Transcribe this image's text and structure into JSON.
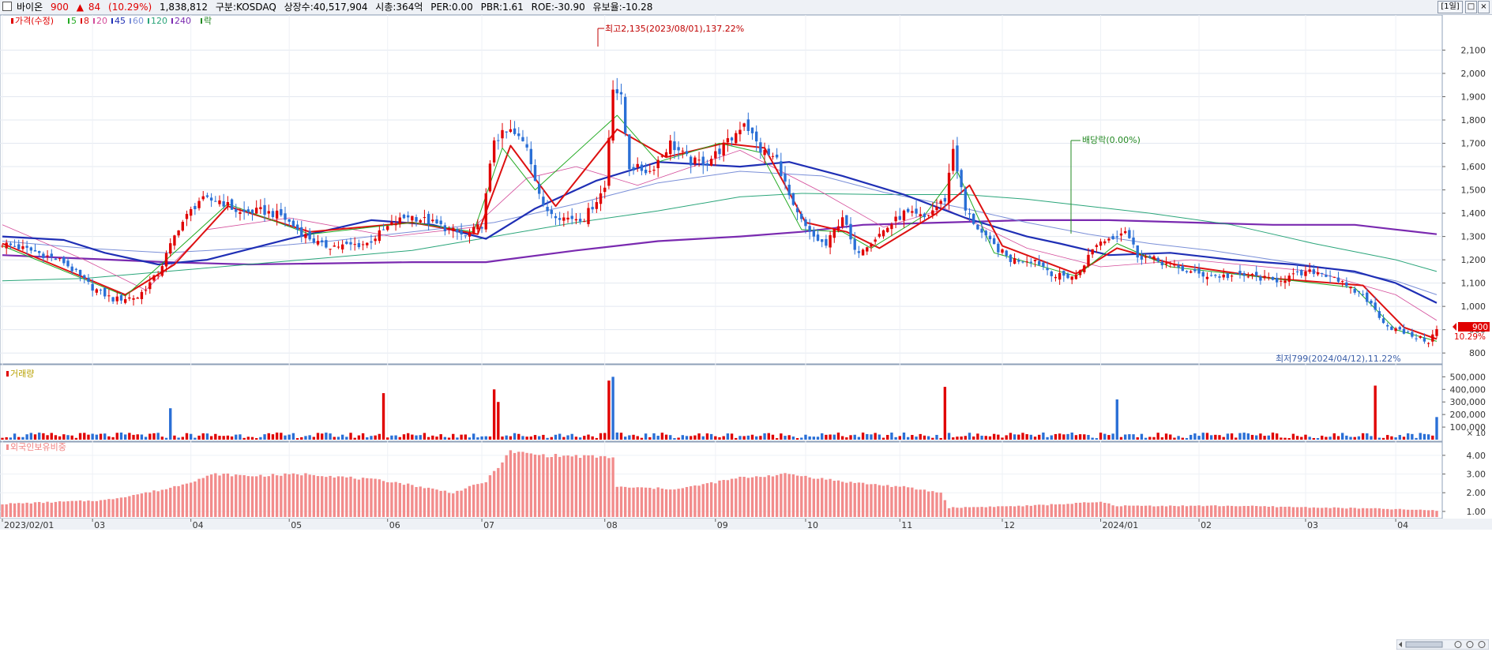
{
  "header": {
    "stock_name": "바이온",
    "price": "900",
    "change_symbol": "▲",
    "change": "84",
    "change_pct": "(10.29%)",
    "volume": "1,838,812",
    "market": "구분:KOSDAQ",
    "listed_shares": "상장수:40,517,904",
    "market_cap": "시총:364억",
    "per": "PER:0.00",
    "pbr": "PBR:1.61",
    "roe": "ROE:-30.90",
    "float": "유보율:-10.28",
    "period_button": "[1일]",
    "restore_icon": "□",
    "close_icon": "×"
  },
  "legend": {
    "price": "가격(수정)",
    "ma5": "5",
    "ma8": "8",
    "ma20": "20",
    "ma45": "45",
    "ma60": "60",
    "ma120": "120",
    "ma240": "240",
    "ex": "락"
  },
  "volume_label": "거래량",
  "foreign_label": "외국인보유비중",
  "colors": {
    "up": "#e00000",
    "down": "#2a6fd6",
    "ma5": "#22aa22",
    "ma8": "#dd1111",
    "ma20": "#d44c9a",
    "ma45": "#1f2fb5",
    "ma60": "#7a8fd8",
    "ma120": "#2aa57a",
    "ma240": "#7a2ab0",
    "foreign_bar": "#f28c8c"
  },
  "chart_data": [
    {
      "type": "candlestick",
      "x_ticks": [
        "2023/02/01",
        "03",
        "04",
        "05",
        "06",
        "07",
        "08",
        "09",
        "10",
        "11",
        "12",
        "2024/01",
        "02",
        "03",
        "04"
      ],
      "y_ticks": [
        "2,100",
        "2,000",
        "1,900",
        "1,800",
        "1,700",
        "1,600",
        "1,500",
        "1,400",
        "1,300",
        "1,200",
        "1,100",
        "1,000",
        "900",
        "800"
      ],
      "ylim": [
        760,
        2210
      ],
      "close_path": [
        [
          0,
          1270
        ],
        [
          8,
          1235
        ],
        [
          15,
          1190
        ],
        [
          22,
          1080
        ],
        [
          27,
          1030
        ],
        [
          33,
          1040
        ],
        [
          38,
          1140
        ],
        [
          43,
          1340
        ],
        [
          48,
          1455
        ],
        [
          53,
          1455
        ],
        [
          58,
          1400
        ],
        [
          63,
          1410
        ],
        [
          68,
          1390
        ],
        [
          73,
          1315
        ],
        [
          78,
          1260
        ],
        [
          84,
          1260
        ],
        [
          89,
          1270
        ],
        [
          94,
          1340
        ],
        [
          99,
          1390
        ],
        [
          104,
          1365
        ],
        [
          109,
          1330
        ],
        [
          113,
          1300
        ],
        [
          117,
          1350
        ],
        [
          120,
          1720
        ],
        [
          124,
          1750
        ],
        [
          128,
          1690
        ],
        [
          132,
          1420
        ],
        [
          137,
          1380
        ],
        [
          142,
          1380
        ],
        [
          147,
          1510
        ],
        [
          149,
          1950
        ],
        [
          151,
          1890
        ],
        [
          153,
          1600
        ],
        [
          158,
          1580
        ],
        [
          163,
          1700
        ],
        [
          168,
          1620
        ],
        [
          172,
          1620
        ],
        [
          178,
          1720
        ],
        [
          181,
          1795
        ],
        [
          185,
          1670
        ],
        [
          189,
          1630
        ],
        [
          193,
          1420
        ],
        [
          197,
          1310
        ],
        [
          201,
          1260
        ],
        [
          205,
          1390
        ],
        [
          208,
          1230
        ],
        [
          212,
          1280
        ],
        [
          216,
          1340
        ],
        [
          220,
          1400
        ],
        [
          225,
          1380
        ],
        [
          230,
          1460
        ],
        [
          232,
          1680
        ],
        [
          235,
          1410
        ],
        [
          240,
          1290
        ],
        [
          246,
          1200
        ],
        [
          252,
          1200
        ],
        [
          257,
          1130
        ],
        [
          262,
          1130
        ],
        [
          267,
          1270
        ],
        [
          271,
          1300
        ],
        [
          274,
          1330
        ],
        [
          277,
          1220
        ],
        [
          282,
          1195
        ],
        [
          286,
          1170
        ],
        [
          291,
          1140
        ],
        [
          296,
          1130
        ],
        [
          300,
          1130
        ],
        [
          305,
          1130
        ],
        [
          310,
          1110
        ],
        [
          315,
          1130
        ],
        [
          320,
          1150
        ],
        [
          325,
          1130
        ],
        [
          328,
          1080
        ],
        [
          332,
          1050
        ],
        [
          338,
          915
        ],
        [
          343,
          880
        ],
        [
          348,
          850
        ],
        [
          350,
          900
        ]
      ],
      "ma5": [
        [
          0,
          1260
        ],
        [
          30,
          1045
        ],
        [
          40,
          1200
        ],
        [
          55,
          1440
        ],
        [
          75,
          1310
        ],
        [
          100,
          1360
        ],
        [
          115,
          1320
        ],
        [
          122,
          1680
        ],
        [
          130,
          1500
        ],
        [
          150,
          1820
        ],
        [
          160,
          1620
        ],
        [
          175,
          1700
        ],
        [
          185,
          1660
        ],
        [
          195,
          1330
        ],
        [
          205,
          1320
        ],
        [
          212,
          1250
        ],
        [
          225,
          1390
        ],
        [
          233,
          1580
        ],
        [
          242,
          1230
        ],
        [
          262,
          1130
        ],
        [
          272,
          1270
        ],
        [
          285,
          1170
        ],
        [
          310,
          1120
        ],
        [
          330,
          1080
        ],
        [
          340,
          900
        ],
        [
          350,
          850
        ]
      ],
      "ma8": [
        [
          0,
          1270
        ],
        [
          30,
          1050
        ],
        [
          42,
          1180
        ],
        [
          55,
          1430
        ],
        [
          75,
          1320
        ],
        [
          100,
          1360
        ],
        [
          116,
          1310
        ],
        [
          124,
          1690
        ],
        [
          135,
          1430
        ],
        [
          150,
          1760
        ],
        [
          162,
          1640
        ],
        [
          176,
          1700
        ],
        [
          186,
          1680
        ],
        [
          196,
          1360
        ],
        [
          206,
          1320
        ],
        [
          214,
          1250
        ],
        [
          228,
          1400
        ],
        [
          236,
          1520
        ],
        [
          244,
          1260
        ],
        [
          262,
          1140
        ],
        [
          272,
          1250
        ],
        [
          286,
          1180
        ],
        [
          310,
          1120
        ],
        [
          332,
          1090
        ],
        [
          342,
          910
        ],
        [
          350,
          860
        ]
      ],
      "ma20": [
        [
          0,
          1350
        ],
        [
          20,
          1200
        ],
        [
          35,
          1070
        ],
        [
          50,
          1330
        ],
        [
          70,
          1380
        ],
        [
          95,
          1300
        ],
        [
          115,
          1340
        ],
        [
          128,
          1550
        ],
        [
          140,
          1600
        ],
        [
          155,
          1520
        ],
        [
          180,
          1670
        ],
        [
          200,
          1490
        ],
        [
          215,
          1340
        ],
        [
          230,
          1420
        ],
        [
          250,
          1250
        ],
        [
          268,
          1170
        ],
        [
          290,
          1200
        ],
        [
          320,
          1150
        ],
        [
          340,
          1050
        ],
        [
          350,
          940
        ]
      ],
      "ma45": [
        [
          0,
          1300
        ],
        [
          15,
          1285
        ],
        [
          25,
          1230
        ],
        [
          38,
          1180
        ],
        [
          50,
          1200
        ],
        [
          70,
          1290
        ],
        [
          90,
          1370
        ],
        [
          105,
          1350
        ],
        [
          118,
          1290
        ],
        [
          130,
          1420
        ],
        [
          145,
          1540
        ],
        [
          160,
          1620
        ],
        [
          170,
          1610
        ],
        [
          180,
          1600
        ],
        [
          192,
          1620
        ],
        [
          205,
          1560
        ],
        [
          220,
          1480
        ],
        [
          235,
          1380
        ],
        [
          250,
          1300
        ],
        [
          258,
          1270
        ],
        [
          270,
          1220
        ],
        [
          285,
          1230
        ],
        [
          300,
          1200
        ],
        [
          315,
          1180
        ],
        [
          330,
          1150
        ],
        [
          340,
          1100
        ],
        [
          350,
          1015
        ]
      ],
      "ma60": [
        [
          0,
          1280
        ],
        [
          20,
          1250
        ],
        [
          40,
          1230
        ],
        [
          60,
          1250
        ],
        [
          80,
          1280
        ],
        [
          100,
          1320
        ],
        [
          120,
          1360
        ],
        [
          140,
          1440
        ],
        [
          160,
          1530
        ],
        [
          180,
          1580
        ],
        [
          200,
          1560
        ],
        [
          215,
          1490
        ],
        [
          235,
          1420
        ],
        [
          250,
          1360
        ],
        [
          265,
          1310
        ],
        [
          280,
          1270
        ],
        [
          295,
          1240
        ],
        [
          310,
          1200
        ],
        [
          325,
          1160
        ],
        [
          340,
          1110
        ],
        [
          350,
          1050
        ]
      ],
      "ma120": [
        [
          0,
          1110
        ],
        [
          20,
          1120
        ],
        [
          40,
          1150
        ],
        [
          60,
          1180
        ],
        [
          80,
          1210
        ],
        [
          100,
          1240
        ],
        [
          120,
          1300
        ],
        [
          140,
          1360
        ],
        [
          160,
          1410
        ],
        [
          180,
          1470
        ],
        [
          195,
          1485
        ],
        [
          215,
          1480
        ],
        [
          235,
          1480
        ],
        [
          250,
          1460
        ],
        [
          265,
          1430
        ],
        [
          280,
          1400
        ],
        [
          300,
          1350
        ],
        [
          320,
          1270
        ],
        [
          340,
          1200
        ],
        [
          350,
          1150
        ]
      ],
      "ma240": [
        [
          0,
          1220
        ],
        [
          20,
          1205
        ],
        [
          40,
          1190
        ],
        [
          60,
          1180
        ],
        [
          80,
          1185
        ],
        [
          100,
          1190
        ],
        [
          118,
          1190
        ],
        [
          140,
          1240
        ],
        [
          160,
          1280
        ],
        [
          180,
          1300
        ],
        [
          195,
          1320
        ],
        [
          210,
          1350
        ],
        [
          230,
          1360
        ],
        [
          250,
          1370
        ],
        [
          270,
          1370
        ],
        [
          290,
          1360
        ],
        [
          310,
          1350
        ],
        [
          330,
          1350
        ],
        [
          340,
          1330
        ],
        [
          350,
          1310
        ]
      ],
      "annotations": {
        "high": "최고2,135(2023/08/01),137.22%",
        "low": "최저799(2024/04/12),11.22%",
        "dividend": "배당락(0.00%)",
        "last_price": "900",
        "last_change": "10.29%"
      }
    },
    {
      "type": "bar",
      "name": "거래량",
      "y_ticks": [
        "500,000",
        "400,000",
        "300,000",
        "200,000",
        "100,000"
      ],
      "unit": "× 10",
      "ylim": [
        0,
        540000
      ],
      "spikes": [
        [
          41,
          250000
        ],
        [
          93,
          370000
        ],
        [
          120,
          400000
        ],
        [
          121,
          300000
        ],
        [
          148,
          470000
        ],
        [
          149,
          500000
        ],
        [
          230,
          420000
        ],
        [
          272,
          320000
        ],
        [
          335,
          430000
        ],
        [
          350,
          180000
        ]
      ]
    },
    {
      "type": "bar",
      "name": "외국인보유비중",
      "y_ticks": [
        "4.00",
        "3.00",
        "2.00",
        "1.00"
      ],
      "ylim": [
        0.7,
        4.5
      ],
      "profile": [
        [
          0,
          1.4
        ],
        [
          25,
          1.6
        ],
        [
          40,
          2.2
        ],
        [
          52,
          3.0
        ],
        [
          60,
          2.9
        ],
        [
          75,
          3.0
        ],
        [
          95,
          2.6
        ],
        [
          110,
          2.0
        ],
        [
          118,
          2.6
        ],
        [
          124,
          4.2
        ],
        [
          132,
          4.0
        ],
        [
          149,
          3.9
        ],
        [
          150,
          2.3
        ],
        [
          165,
          2.2
        ],
        [
          180,
          2.8
        ],
        [
          192,
          3.0
        ],
        [
          205,
          2.6
        ],
        [
          220,
          2.3
        ],
        [
          229,
          2.0
        ],
        [
          231,
          1.2
        ],
        [
          250,
          1.3
        ],
        [
          268,
          1.5
        ],
        [
          272,
          1.3
        ],
        [
          300,
          1.3
        ],
        [
          335,
          1.15
        ],
        [
          350,
          1.05
        ]
      ]
    }
  ]
}
